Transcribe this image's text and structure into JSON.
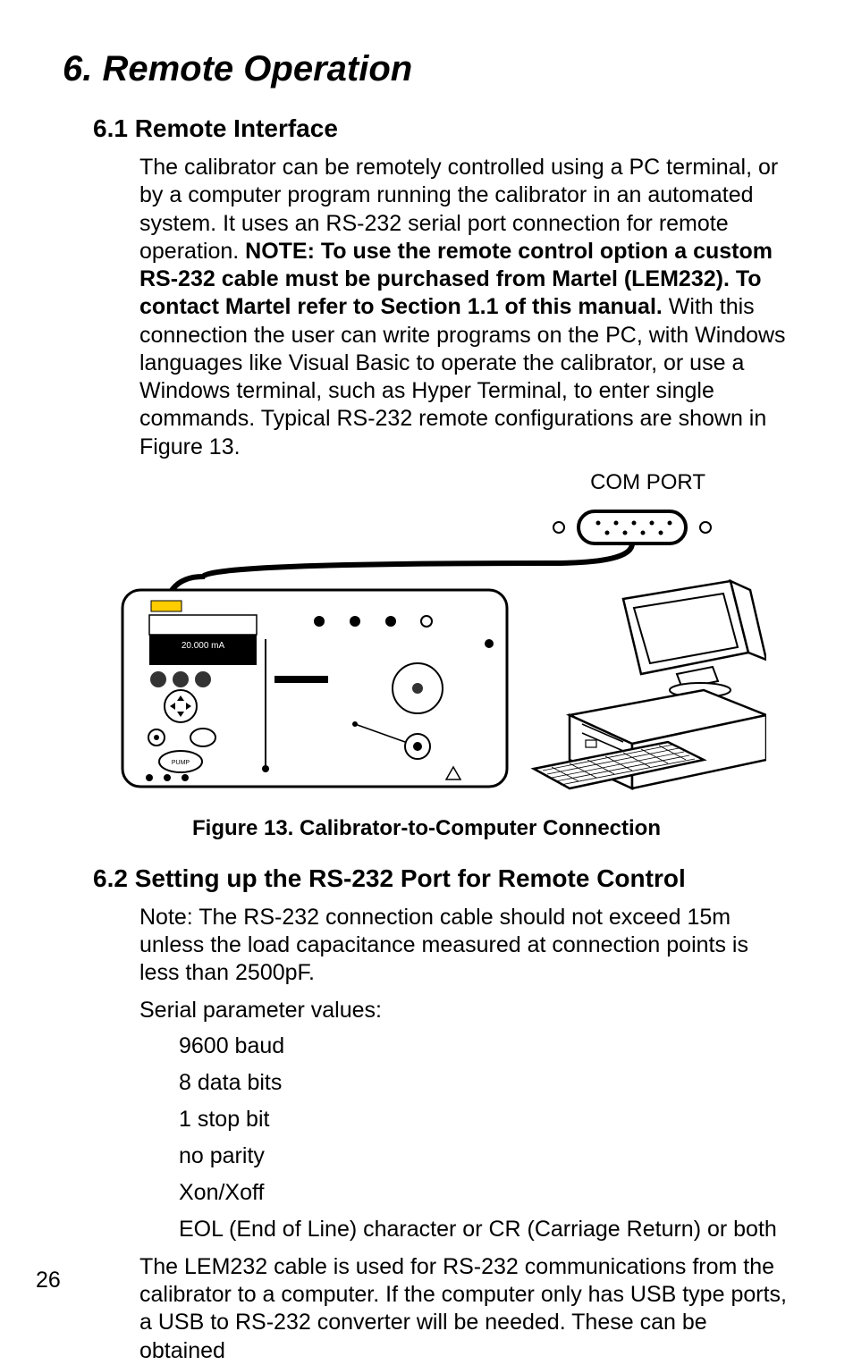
{
  "title": "6. Remote Operation",
  "sec61": {
    "heading": "6.1  Remote Interface",
    "p1_a": "The calibrator can be remotely controlled using a PC terminal, or by a computer program running the calibrator in an automated system. It uses an RS-232 serial port connection for remote operation. ",
    "p1_bold": "NOTE: To use the remote control option a custom RS-232 cable must be purchased from Martel (LEM232). To contact Martel refer to Section 1.1 of this manual.",
    "p1_b": " With this connection the user can write programs on the PC, with Windows languages like Visual Basic to operate the calibrator, or use a Windows terminal, such as Hyper Terminal, to enter single commands. Typical RS-232 remote configurations are shown in Figure 13."
  },
  "figure": {
    "com_label": "COM PORT",
    "caption": "Figure 13. Calibrator-to-Computer Connection"
  },
  "sec62": {
    "heading": "6.2 Setting up the RS-232 Port for Remote Control",
    "p1": "Note: The RS-232 connection cable should not exceed 15m unless the load capacitance measured at connection points is less than 2500pF.",
    "p2": "Serial parameter values:",
    "items": {
      "a": "9600 baud",
      "b": "8 data bits",
      "c": "1 stop bit",
      "d": "no parity",
      "e": "Xon/Xoff",
      "f": "EOL (End of Line) character or CR (Carriage Return) or both"
    },
    "p3": "The LEM232 cable is used for RS-232 communications from the calibrator to a computer. If the computer only has USB type ports, a USB to RS-232 converter will be needed. These can be obtained"
  },
  "pageNumber": "26"
}
